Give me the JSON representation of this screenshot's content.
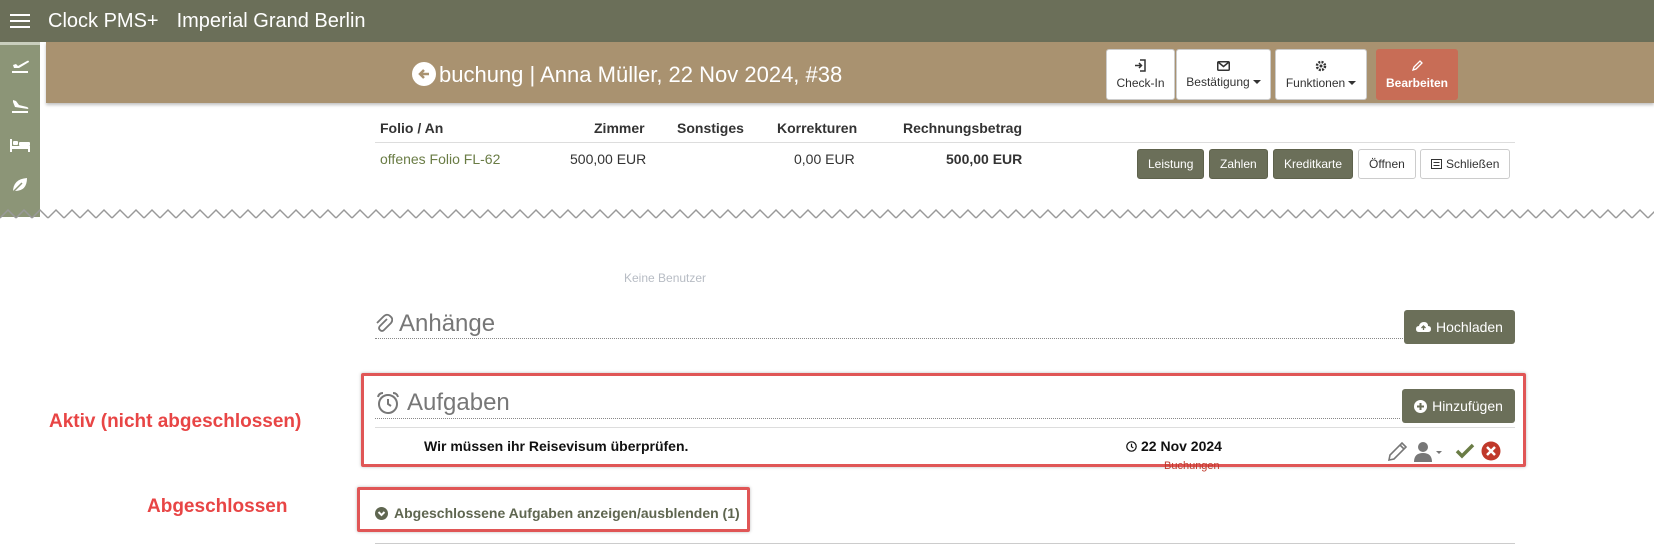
{
  "topbar": {
    "brand": "Clock PMS+",
    "hotel": "Imperial Grand Berlin"
  },
  "sidebar": {
    "icons": [
      "plane-departure-icon",
      "plane-arrival-icon",
      "bed-icon",
      "leaf-icon"
    ]
  },
  "header": {
    "title": "buchung | Anna Müller, 22 Nov 2024, #38",
    "buttons": {
      "checkin": "Check-In",
      "confirmation": "Bestätigung",
      "functions": "Funktionen",
      "edit": "Bearbeiten"
    }
  },
  "folio": {
    "columns": [
      "Folio / An",
      "Zimmer",
      "Sonstiges",
      "Korrekturen",
      "Rechnungsbetrag"
    ],
    "row": {
      "folio": "offenes Folio FL-62",
      "zimmer": "500,00 EUR",
      "sonstiges": "",
      "korrekturen": "0,00 EUR",
      "rechnungsbetrag": "500,00 EUR"
    },
    "buttons": {
      "leistung": "Leistung",
      "zahlen": "Zahlen",
      "kreditkarte": "Kreditkarte",
      "oeffnen": "Öffnen",
      "schliessen": "Schließen"
    }
  },
  "faded_text": "Keine Benutzer",
  "attachments": {
    "title": "Anhänge",
    "upload": "Hochladen"
  },
  "tasks": {
    "title": "Aufgaben",
    "add": "Hinzufügen",
    "items": [
      {
        "text": "Wir müssen ihr Reisevisum überprüfen.",
        "date": "22 Nov 2024",
        "category": "Buchungen"
      }
    ],
    "toggle_completed": "Abgeschlossene Aufgaben anzeigen/ausblenden (1)"
  },
  "annotations": {
    "active": "Aktiv (nicht abgeschlossen)",
    "completed": "Abgeschlossen"
  },
  "colors": {
    "accent": "#6b6f59",
    "header": "#a99270",
    "edit": "#c86d56",
    "annotation": "#e84545"
  }
}
